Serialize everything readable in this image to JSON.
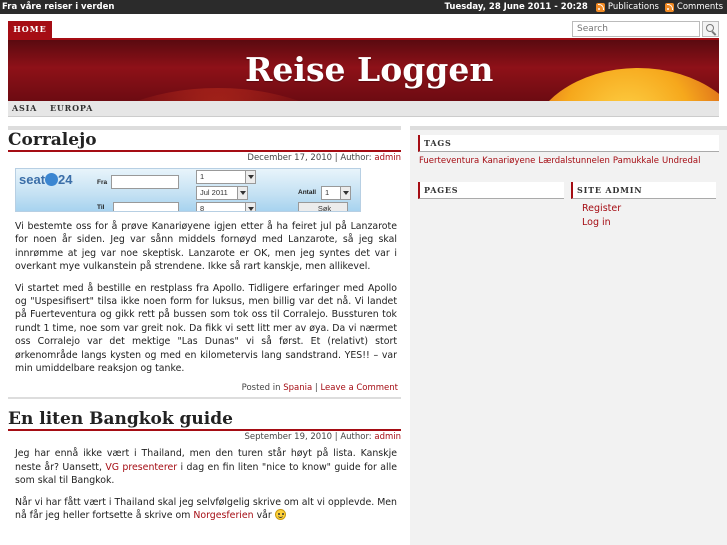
{
  "topbar": {
    "tagline": "Fra våre reiser i verden",
    "date": "Tuesday, 28 June 2011 - 20:28",
    "publications": "Publications",
    "comments": "Comments"
  },
  "nav": {
    "home": "HOME"
  },
  "search": {
    "placeholder": "Search"
  },
  "header": {
    "title": "Reise Loggen"
  },
  "categories": [
    "ASIA",
    "EUROPA"
  ],
  "posts": [
    {
      "title": "Corralejo",
      "date": "December 17, 2010",
      "author_label": "| Author:",
      "author": "admin",
      "widget": {
        "brand": "seat",
        "brand_num": "24",
        "from_label": "Fra",
        "to_label": "Til",
        "day1": "1",
        "month1": "Jul 2011",
        "adults_label": "Antall",
        "adults": "1",
        "day2": "8",
        "search_label": "Søk"
      },
      "paragraphs": [
        "Vi bestemte oss for å prøve Kanariøyene igjen etter å ha feiret jul på Lanzarote for noen år siden. Jeg var sånn middels fornøyd med Lanzarote, så jeg skal innrømme at jeg var noe skeptisk. Lanzarote er OK, men jeg syntes det var i overkant mye vulkanstein på strendene. Ikke så rart kanskje, men allikevel.",
        "Vi startet med å bestille en restplass fra Apollo. Tidligere erfaringer med Apollo og \"Uspesifisert\" tilsa ikke noen form for luksus, men billig var det nå. Vi landet på Fuerteventura og gikk rett på bussen som tok oss til Corralejo. Bussturen tok rundt 1 time, noe som var greit nok. Da fikk vi sett litt mer av øya. Da vi nærmet oss Corralejo var det mektige \"Las Dunas\" vi så først. Et (relativt) stort ørkenområde langs kysten og med en kilometervis lang sandstrand. YES!! – var min umiddelbare reaksjon og tanke."
      ],
      "posted_in_label": "Posted in",
      "category": "Spania",
      "leave_comment": "Leave a Comment"
    },
    {
      "title": "En liten Bangkok guide",
      "date": "September 19, 2010",
      "author_label": "| Author:",
      "author": "admin",
      "p1_before": "Jeg har ennå ikke vært i Thailand, men den turen står høyt på lista. Kanskje neste år? Uansett, ",
      "p1_link": "VG presenterer",
      "p1_after": " i dag en fin liten \"nice to know\" guide for alle som skal til Bangkok.",
      "p2_before": "Når vi har fått vært i Thailand skal jeg selvfølgelig skrive om alt vi opplevde. Men nå får jeg heller fortsette å skrive om ",
      "p2_link": "Norgesferien",
      "p2_after": " vår "
    }
  ],
  "sidebar": {
    "tags_title": "TAGS",
    "tags": [
      "Fuerteventura",
      "Kanariøyene",
      "Lærdalstunnelen",
      "Pamukkale",
      "Undredal"
    ],
    "pages_title": "PAGES",
    "admin_title": "SITE ADMIN",
    "admin_links": [
      "Register",
      "Log in"
    ]
  },
  "colors": {
    "accent": "#a50d14",
    "topbar": "#2b2b2b"
  }
}
